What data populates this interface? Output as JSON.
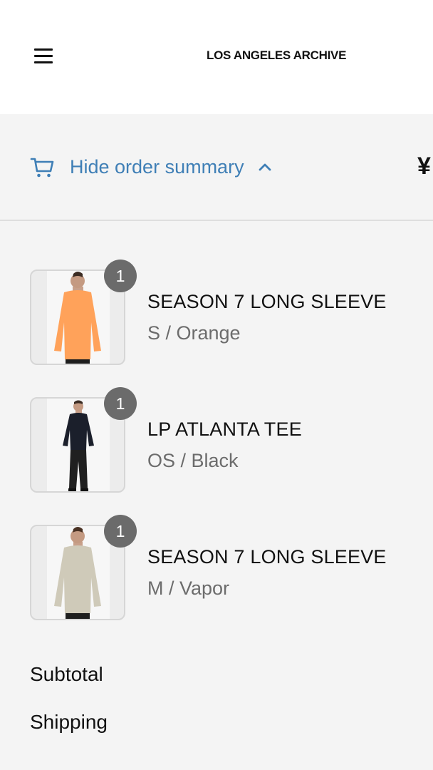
{
  "header": {
    "logo": "LOS ANGELES ARCHIVE",
    "menu_icon": "hamburger-menu-icon"
  },
  "summary": {
    "toggle_label": "Hide order summary",
    "cart_icon": "cart-icon",
    "chevron_icon": "chevron-up-icon",
    "total": "¥",
    "accent_color": "#3f7fb6"
  },
  "items": [
    {
      "name": "SEASON 7 LONG SLEEVE",
      "variant": "S / Orange",
      "quantity": "1",
      "shirt_color": "#ffa25a",
      "pants_color": "#1e1e1e"
    },
    {
      "name": "LP ATLANTA TEE",
      "variant": "OS / Black",
      "quantity": "1",
      "shirt_color": "#1b1f2b",
      "pants_color": "#202020"
    },
    {
      "name": "SEASON 7 LONG SLEEVE",
      "variant": "M / Vapor",
      "quantity": "1",
      "shirt_color": "#cfcab9",
      "pants_color": "#1e1e1e"
    }
  ],
  "totals": {
    "subtotal_label": "Subtotal",
    "shipping_label": "Shipping"
  }
}
